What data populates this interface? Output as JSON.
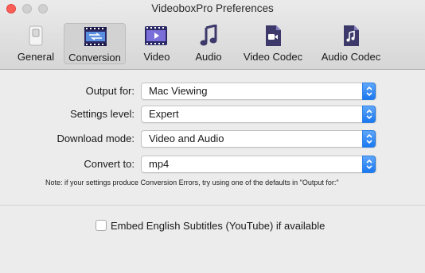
{
  "window": {
    "title": "VideoboxPro Preferences"
  },
  "toolbar": {
    "items": [
      {
        "label": "General",
        "icon": "switch-icon"
      },
      {
        "label": "Conversion",
        "icon": "film-arrows-icon",
        "selected": true
      },
      {
        "label": "Video",
        "icon": "film-icon"
      },
      {
        "label": "Audio",
        "icon": "music-note-icon"
      },
      {
        "label": "Video Codec",
        "icon": "video-file-icon"
      },
      {
        "label": "Audio Codec",
        "icon": "audio-file-icon"
      }
    ]
  },
  "settings": {
    "output_for": {
      "label": "Output for:",
      "value": "Mac Viewing"
    },
    "settings_level": {
      "label": "Settings level:",
      "value": "Expert"
    },
    "download_mode": {
      "label": "Download mode:",
      "value": "Video and Audio"
    },
    "convert_to": {
      "label": "Convert to:",
      "value": "mp4"
    },
    "note": "Note: if your settings produce Conversion Errors, try using one of the defaults in \"Output for:\""
  },
  "subtitles": {
    "label": "Embed English Subtitles (YouTube) if available",
    "checked": false
  },
  "colors": {
    "accent": "#1a78f0",
    "close": "#fc5f57",
    "icon_purple": "#3d3a6b"
  }
}
